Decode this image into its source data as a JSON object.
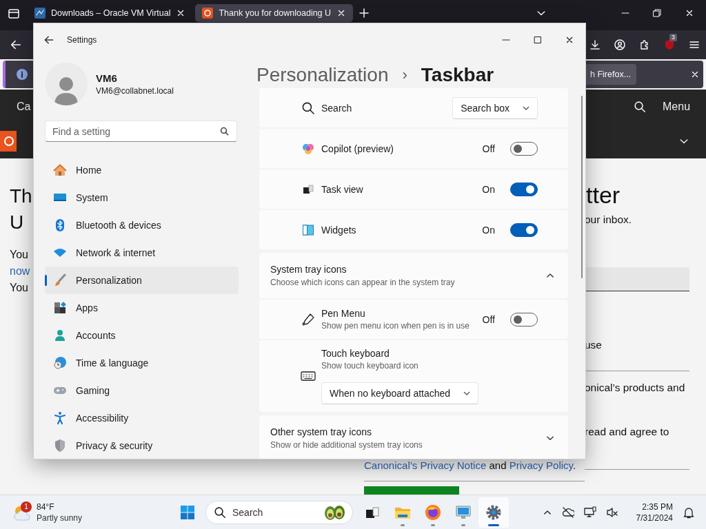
{
  "browser": {
    "tabs": [
      {
        "title": "Downloads – Oracle VM Virtual",
        "selected": false
      },
      {
        "title": "Thank you for downloading U",
        "selected": true
      }
    ],
    "extension_badge": "3",
    "notification": {
      "button": "h Firefox..."
    },
    "site": {
      "brand": "Ca",
      "menu": "Menu",
      "left": {
        "heading": [
          "Th",
          "U"
        ],
        "lines": [
          {
            "text": "You",
            "kind": "text"
          },
          {
            "text": "now",
            "kind": "link"
          },
          {
            "text": "You",
            "kind": "text"
          }
        ]
      },
      "right": {
        "heading": "tter",
        "intro": "our inbox.",
        "option": "use",
        "consent": "onical’s products and",
        "agree": "read and agree to"
      },
      "legal": [
        {
          "text": "Canonical’s Privacy Notice",
          "kind": "link"
        },
        {
          "text": " and ",
          "kind": "text"
        },
        {
          "text": "Privacy Policy",
          "kind": "link"
        },
        {
          "text": ".",
          "kind": "text"
        }
      ]
    }
  },
  "settings": {
    "title": "Settings",
    "user": {
      "name": "VM6",
      "email": "VM6@collabnet.local"
    },
    "search": {
      "placeholder": "Find a setting"
    },
    "nav": [
      {
        "label": "Home",
        "selected": false
      },
      {
        "label": "System",
        "selected": false
      },
      {
        "label": "Bluetooth & devices",
        "selected": false
      },
      {
        "label": "Network & internet",
        "selected": false
      },
      {
        "label": "Personalization",
        "selected": true
      },
      {
        "label": "Apps",
        "selected": false
      },
      {
        "label": "Accounts",
        "selected": false
      },
      {
        "label": "Time & language",
        "selected": false
      },
      {
        "label": "Gaming",
        "selected": false
      },
      {
        "label": "Accessibility",
        "selected": false
      },
      {
        "label": "Privacy & security",
        "selected": false
      }
    ],
    "breadcrumb": {
      "parent": "Personalization",
      "separator": "›",
      "current": "Taskbar"
    },
    "groups": [
      {
        "kind": "list",
        "rows": [
          {
            "kind": "dropdown",
            "label": "Search",
            "value": "Search box"
          },
          {
            "kind": "toggle",
            "label": "Copilot (preview)",
            "state_text": "Off",
            "on": false
          },
          {
            "kind": "toggle",
            "label": "Task view",
            "state_text": "On",
            "on": true
          },
          {
            "kind": "toggle",
            "label": "Widgets",
            "state_text": "On",
            "on": true
          }
        ]
      },
      {
        "kind": "expander",
        "title": "System tray icons",
        "subtitle": "Choose which icons can appear in the system tray",
        "expanded": true,
        "rows": [
          {
            "kind": "toggle",
            "label": "Pen Menu",
            "description": "Show pen menu icon when pen is in use",
            "state_text": "Off",
            "on": false
          },
          {
            "kind": "dropdown_below",
            "label": "Touch keyboard",
            "description": "Show touch keyboard icon",
            "value": "When no keyboard attached"
          }
        ]
      },
      {
        "kind": "expander",
        "title": "Other system tray icons",
        "subtitle": "Show or hide additional system tray icons",
        "expanded": false
      }
    ]
  },
  "taskbar": {
    "weather": {
      "badge": "1",
      "temperature": "84°F",
      "condition": "Partly sunny"
    },
    "search": {
      "label": "Search"
    },
    "apps": [
      {
        "running": false,
        "selected": false
      },
      {
        "running": true,
        "selected": false
      },
      {
        "running": true,
        "selected": false
      },
      {
        "running": true,
        "selected": false
      },
      {
        "running": true,
        "selected": true
      }
    ],
    "clock": {
      "time": "2:35 PM",
      "date": "7/31/2024"
    }
  }
}
